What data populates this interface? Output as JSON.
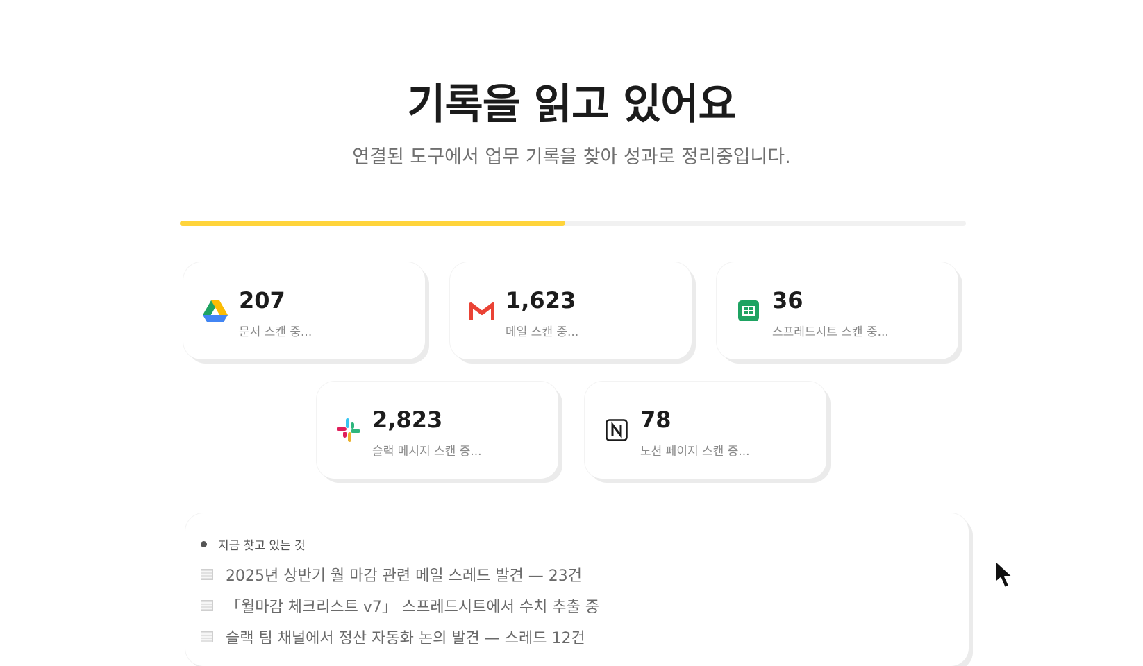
{
  "header": {
    "title": "기록을 읽고 있어요",
    "subtitle": "연결된 도구에서 업무 기록을 찾아 성과로 정리중입니다."
  },
  "progress": {
    "percent": 49,
    "color": "#ffd43b"
  },
  "sources": [
    {
      "icon": "google-drive-icon",
      "count": "207",
      "status": "문서 스캔 중..."
    },
    {
      "icon": "gmail-icon",
      "count": "1,623",
      "status": "메일 스캔 중..."
    },
    {
      "icon": "google-sheets-icon",
      "count": "36",
      "status": "스프레드시트 스캔 중..."
    },
    {
      "icon": "slack-icon",
      "count": "2,823",
      "status": "슬랙 메시지 스캔 중..."
    },
    {
      "icon": "notion-icon",
      "count": "78",
      "status": "노션 페이지 스캔 중..."
    }
  ],
  "findings": {
    "header": "지금 찾고 있는 것",
    "items": [
      "2025년 상반기 월 마감 관련 메일 스레드 발견 — 23건",
      "「월마감 체크리스트 v7」 스프레드시트에서 수치 추출 중",
      "슬랙 팀 채널에서 정산 자동화 논의 발견 — 스레드 12건"
    ]
  }
}
